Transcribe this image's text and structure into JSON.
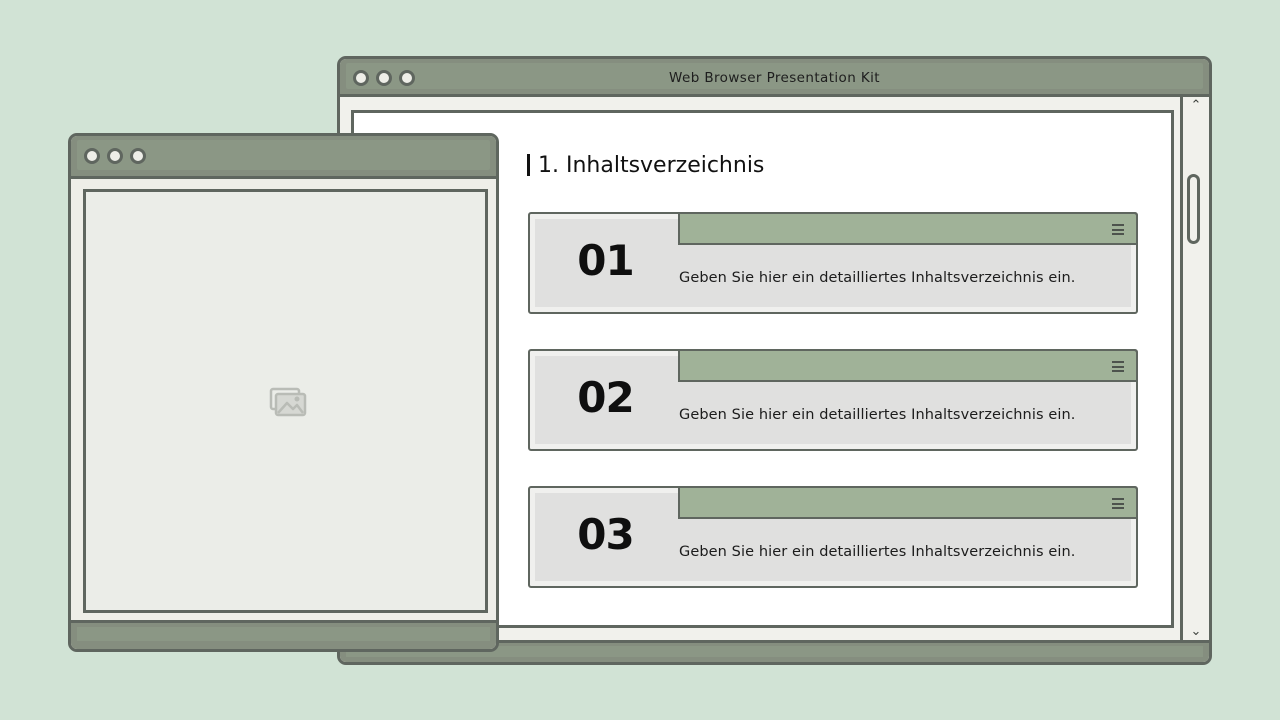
{
  "main_window": {
    "title": "Web Browser Presentation Kit"
  },
  "section": {
    "heading": "1. Inhaltsverzeichnis"
  },
  "toc_items": [
    {
      "number": "01",
      "text": "Geben Sie hier ein detailliertes Inhaltsverzeichnis ein."
    },
    {
      "number": "02",
      "text": "Geben Sie hier ein detailliertes Inhaltsverzeichnis ein."
    },
    {
      "number": "03",
      "text": "Geben Sie hier ein detailliertes Inhaltsverzeichnis ein."
    }
  ],
  "icons": {
    "window_controls": [
      "window-dot-icon",
      "window-dot-icon",
      "window-dot-icon"
    ],
    "scroll_up": "chevron-up-icon",
    "scroll_down": "chevron-down-icon",
    "card_menu": "menu-icon",
    "image_placeholder": "image-placeholder-icon"
  },
  "colors": {
    "background": "#d1e3d5",
    "titlebar": "#858e7f",
    "card_tab": "#a0b298",
    "border": "#5f665f"
  }
}
